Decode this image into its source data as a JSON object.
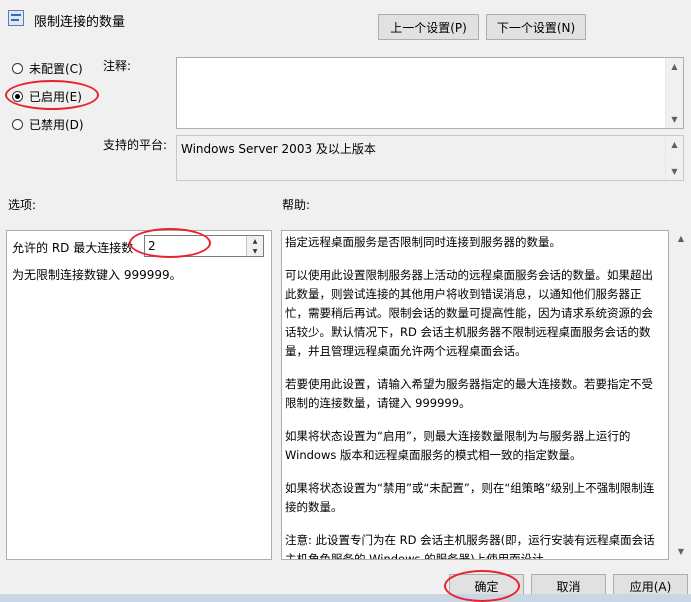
{
  "window": {
    "title": "限制连接的数量",
    "icon": "policy-setting-icon"
  },
  "nav": {
    "prev_label": "上一个设置(P)",
    "next_label": "下一个设置(N)"
  },
  "state": {
    "options": [
      {
        "label": "未配置(C)",
        "selected": false
      },
      {
        "label": "已启用(E)",
        "selected": true
      },
      {
        "label": "已禁用(D)",
        "selected": false
      }
    ]
  },
  "comment": {
    "label": "注释:",
    "value": ""
  },
  "platform": {
    "label": "支持的平台:",
    "value": "Windows Server 2003 及以上版本"
  },
  "options_section": {
    "label": "选项:",
    "max_connections_label": "允许的 RD 最大连接数",
    "max_connections_value": "2",
    "hint": "为无限制连接数键入 999999。"
  },
  "help_section": {
    "label": "帮助:",
    "paragraphs": [
      "指定远程桌面服务是否限制同时连接到服务器的数量。",
      "可以使用此设置限制服务器上活动的远程桌面服务会话的数量。如果超出此数量，则尝试连接的其他用户将收到错误消息，以通知他们服务器正忙，需要稍后再试。限制会话的数量可提高性能，因为请求系统资源的会话较少。默认情况下，RD 会话主机服务器不限制远程桌面服务会话的数量，并且管理远程桌面允许两个远程桌面会话。",
      "若要使用此设置，请输入希望为服务器指定的最大连接数。若要指定不受限制的连接数量，请键入 999999。",
      "如果将状态设置为“启用”，则最大连接数量限制为与服务器上运行的 Windows 版本和远程桌面服务的模式相一致的指定数量。",
      "如果将状态设置为“禁用”或“未配置”，则在“组策略”级别上不强制限制连接的数量。",
      "注意: 此设置专门为在 RD 会话主机服务器(即，运行安装有远程桌面会话主机角色服务的 Windows 的服务器)上使用而设计。"
    ]
  },
  "footer": {
    "ok_label": "确定",
    "cancel_label": "取消",
    "apply_label": "应用(A)"
  },
  "colors": {
    "annotation": "#e8232f",
    "panel": "#f0f0f0"
  }
}
